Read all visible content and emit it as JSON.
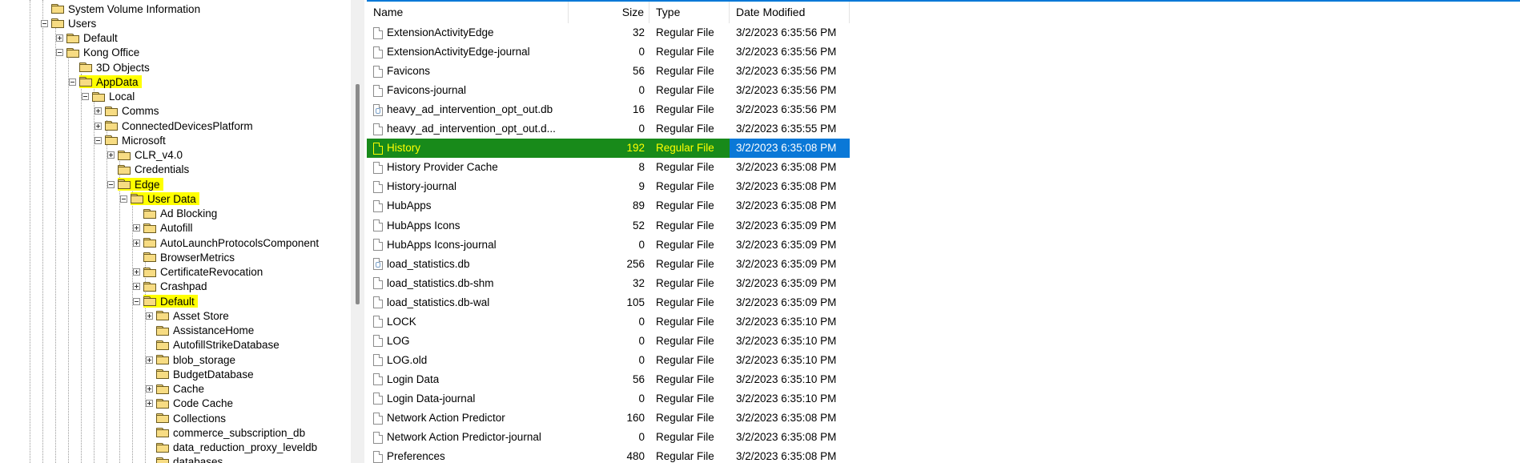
{
  "tree": {
    "items": [
      {
        "label": "System Volume Information",
        "expander": "none",
        "highlight": false
      },
      {
        "label": "Users",
        "expander": "minus",
        "highlight": false
      },
      {
        "label": "Default",
        "expander": "plus",
        "highlight": false
      },
      {
        "label": "Kong Office",
        "expander": "minus",
        "highlight": false
      },
      {
        "label": "3D Objects",
        "expander": "none",
        "highlight": false
      },
      {
        "label": "AppData",
        "expander": "minus",
        "highlight": true
      },
      {
        "label": "Local",
        "expander": "minus",
        "highlight": false
      },
      {
        "label": "Comms",
        "expander": "plus",
        "highlight": false
      },
      {
        "label": "ConnectedDevicesPlatform",
        "expander": "plus",
        "highlight": false
      },
      {
        "label": "Microsoft",
        "expander": "minus",
        "highlight": false
      },
      {
        "label": "CLR_v4.0",
        "expander": "plus",
        "highlight": false
      },
      {
        "label": "Credentials",
        "expander": "none",
        "highlight": false
      },
      {
        "label": "Edge",
        "expander": "minus",
        "highlight": true
      },
      {
        "label": "User Data",
        "expander": "minus",
        "highlight": true
      },
      {
        "label": "Ad Blocking",
        "expander": "none",
        "highlight": false
      },
      {
        "label": "Autofill",
        "expander": "plus",
        "highlight": false
      },
      {
        "label": "AutoLaunchProtocolsComponent",
        "expander": "plus",
        "highlight": false
      },
      {
        "label": "BrowserMetrics",
        "expander": "none",
        "highlight": false
      },
      {
        "label": "CertificateRevocation",
        "expander": "plus",
        "highlight": false
      },
      {
        "label": "Crashpad",
        "expander": "plus",
        "highlight": false
      },
      {
        "label": "Default",
        "expander": "minus",
        "highlight": true
      },
      {
        "label": "Asset Store",
        "expander": "plus",
        "highlight": false
      },
      {
        "label": "AssistanceHome",
        "expander": "none",
        "highlight": false
      },
      {
        "label": "AutofillStrikeDatabase",
        "expander": "none",
        "highlight": false
      },
      {
        "label": "blob_storage",
        "expander": "plus",
        "highlight": false
      },
      {
        "label": "BudgetDatabase",
        "expander": "none",
        "highlight": false
      },
      {
        "label": "Cache",
        "expander": "plus",
        "highlight": false
      },
      {
        "label": "Code Cache",
        "expander": "plus",
        "highlight": false
      },
      {
        "label": "Collections",
        "expander": "none",
        "highlight": false
      },
      {
        "label": "commerce_subscription_db",
        "expander": "none",
        "highlight": false
      },
      {
        "label": "data_reduction_proxy_leveldb",
        "expander": "none",
        "highlight": false
      },
      {
        "label": "databases",
        "expander": "none",
        "highlight": false
      }
    ]
  },
  "list": {
    "headers": {
      "name": "Name",
      "size": "Size",
      "type": "Type",
      "date": "Date Modified"
    },
    "selected_index": 6,
    "rows": [
      {
        "name": "ExtensionActivityEdge",
        "size": "32",
        "type": "Regular File",
        "date": "3/2/2023 6:35:56 PM",
        "icon": "file-icon"
      },
      {
        "name": "ExtensionActivityEdge-journal",
        "size": "0",
        "type": "Regular File",
        "date": "3/2/2023 6:35:56 PM",
        "icon": "file-icon"
      },
      {
        "name": "Favicons",
        "size": "56",
        "type": "Regular File",
        "date": "3/2/2023 6:35:56 PM",
        "icon": "file-icon"
      },
      {
        "name": "Favicons-journal",
        "size": "0",
        "type": "Regular File",
        "date": "3/2/2023 6:35:56 PM",
        "icon": "file-icon"
      },
      {
        "name": "heavy_ad_intervention_opt_out.db",
        "size": "16",
        "type": "Regular File",
        "date": "3/2/2023 6:35:56 PM",
        "icon": "database-file-icon"
      },
      {
        "name": "heavy_ad_intervention_opt_out.d...",
        "size": "0",
        "type": "Regular File",
        "date": "3/2/2023 6:35:55 PM",
        "icon": "file-icon"
      },
      {
        "name": "History",
        "size": "192",
        "type": "Regular File",
        "date": "3/2/2023 6:35:08 PM",
        "icon": "file-icon"
      },
      {
        "name": "History Provider Cache",
        "size": "8",
        "type": "Regular File",
        "date": "3/2/2023 6:35:08 PM",
        "icon": "file-icon"
      },
      {
        "name": "History-journal",
        "size": "9",
        "type": "Regular File",
        "date": "3/2/2023 6:35:08 PM",
        "icon": "file-icon"
      },
      {
        "name": "HubApps",
        "size": "89",
        "type": "Regular File",
        "date": "3/2/2023 6:35:08 PM",
        "icon": "file-icon"
      },
      {
        "name": "HubApps Icons",
        "size": "52",
        "type": "Regular File",
        "date": "3/2/2023 6:35:09 PM",
        "icon": "file-icon"
      },
      {
        "name": "HubApps Icons-journal",
        "size": "0",
        "type": "Regular File",
        "date": "3/2/2023 6:35:09 PM",
        "icon": "file-icon"
      },
      {
        "name": "load_statistics.db",
        "size": "256",
        "type": "Regular File",
        "date": "3/2/2023 6:35:09 PM",
        "icon": "database-file-icon"
      },
      {
        "name": "load_statistics.db-shm",
        "size": "32",
        "type": "Regular File",
        "date": "3/2/2023 6:35:09 PM",
        "icon": "file-icon"
      },
      {
        "name": "load_statistics.db-wal",
        "size": "105",
        "type": "Regular File",
        "date": "3/2/2023 6:35:09 PM",
        "icon": "file-icon"
      },
      {
        "name": "LOCK",
        "size": "0",
        "type": "Regular File",
        "date": "3/2/2023 6:35:10 PM",
        "icon": "file-icon"
      },
      {
        "name": "LOG",
        "size": "0",
        "type": "Regular File",
        "date": "3/2/2023 6:35:10 PM",
        "icon": "file-icon"
      },
      {
        "name": "LOG.old",
        "size": "0",
        "type": "Regular File",
        "date": "3/2/2023 6:35:10 PM",
        "icon": "file-icon"
      },
      {
        "name": "Login Data",
        "size": "56",
        "type": "Regular File",
        "date": "3/2/2023 6:35:10 PM",
        "icon": "file-icon"
      },
      {
        "name": "Login Data-journal",
        "size": "0",
        "type": "Regular File",
        "date": "3/2/2023 6:35:10 PM",
        "icon": "file-icon"
      },
      {
        "name": "Network Action Predictor",
        "size": "160",
        "type": "Regular File",
        "date": "3/2/2023 6:35:08 PM",
        "icon": "file-icon"
      },
      {
        "name": "Network Action Predictor-journal",
        "size": "0",
        "type": "Regular File",
        "date": "3/2/2023 6:35:08 PM",
        "icon": "file-icon"
      },
      {
        "name": "Preferences",
        "size": "480",
        "type": "Regular File",
        "date": "3/2/2023 6:35:08 PM",
        "icon": "file-icon"
      }
    ]
  },
  "colors": {
    "highlight_yellow": "#ffff00",
    "selection_blue": "#0a78d7",
    "selection_green": "#188a1a",
    "folder_fill": "#f7dc83"
  }
}
